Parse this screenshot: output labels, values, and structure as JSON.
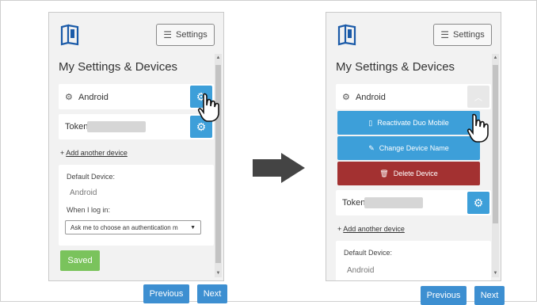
{
  "left": {
    "settings_label": "Settings",
    "title": "My Settings & Devices",
    "device_android": "Android",
    "device_token": "Token",
    "add_device_prefix": "+ ",
    "add_device_link": "Add another device",
    "default_device_label": "Default Device:",
    "default_device_value": "Android",
    "when_login_label": "When I log in:",
    "login_select_value": "Ask me to choose an authentication m",
    "saved_label": "Saved"
  },
  "right": {
    "settings_label": "Settings",
    "title": "My Settings & Devices",
    "device_android": "Android",
    "reactivate_label": "Reactivate Duo Mobile",
    "change_name_label": "Change Device Name",
    "delete_label": "Delete Device",
    "device_token": "Token",
    "add_device_prefix": "+ ",
    "add_device_link": "Add another device",
    "default_device_label": "Default Device:",
    "default_device_value": "Android"
  },
  "nav": {
    "previous_label": "Previous",
    "next_label": "Next"
  },
  "colors": {
    "accent_blue": "#3d9fd9",
    "saved_green": "#7ac35c",
    "delete_red": "#a33131"
  }
}
